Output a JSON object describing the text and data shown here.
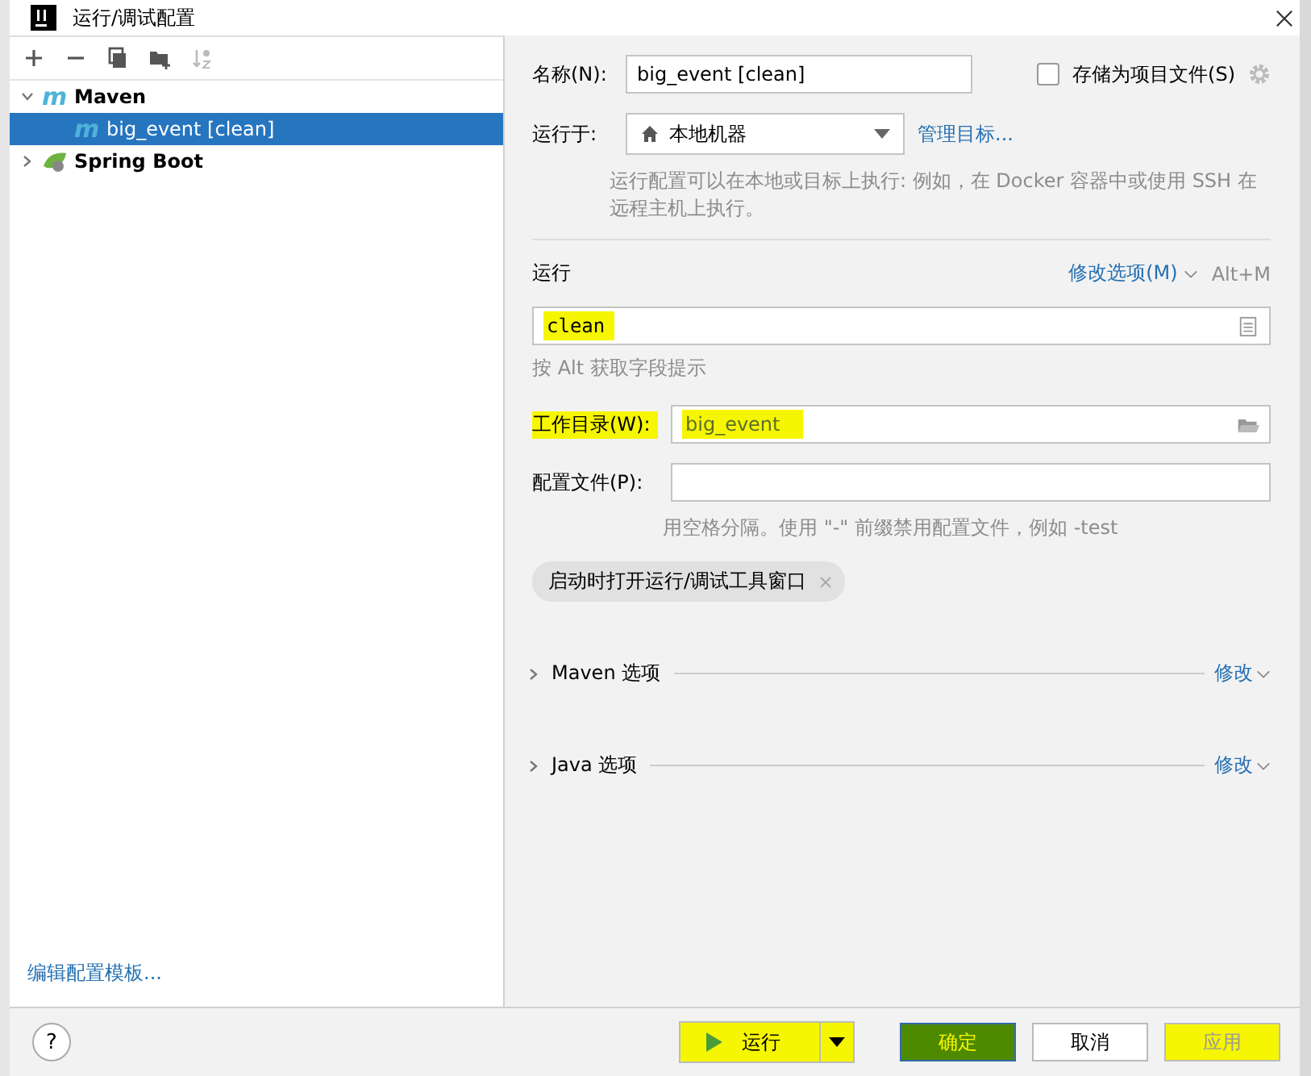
{
  "window": {
    "title": "运行/调试配置"
  },
  "tree": [
    {
      "label": "Maven",
      "kind": "maven",
      "icon": "m",
      "expanded": true,
      "selected": false,
      "children": [
        {
          "label": "big_event [clean]",
          "kind": "maven",
          "icon": "m",
          "selected": true
        }
      ]
    },
    {
      "label": "Spring Boot",
      "kind": "spring",
      "expanded": false,
      "selected": false
    }
  ],
  "edit_templates_link": "编辑配置模板...",
  "name": {
    "label": "名称(N):",
    "value": "big_event [clean]"
  },
  "store_as_file": {
    "label": "存储为项目文件(S)",
    "checked": false
  },
  "run_on": {
    "label": "运行于:",
    "value": "本地机器",
    "link": "管理目标...",
    "hint": "运行配置可以在本地或目标上执行: 例如，在 Docker 容器中或使用 SSH 在远程主机上执行。"
  },
  "run_section": {
    "title": "运行",
    "modify": "修改选项(M)",
    "shortcut": "Alt+M"
  },
  "command": {
    "value": "clean",
    "highlighted": true,
    "hint": "按 Alt 获取字段提示"
  },
  "workdir": {
    "label": "工作目录(W):",
    "value": "big_event",
    "highlighted": true
  },
  "profiles": {
    "label": "配置文件(P):",
    "hint": "用空格分隔。使用 \"-\" 前缀禁用配置文件，例如 -test"
  },
  "tag": "启动时打开运行/调试工具窗口",
  "sections": [
    {
      "label": "Maven 选项",
      "action": "修改"
    },
    {
      "label": "Java 选项",
      "action": "修改"
    }
  ],
  "help_button": "?",
  "buttons": [
    {
      "label": "运行",
      "kind": "run",
      "highlighted": true,
      "disabled": false
    },
    {
      "label": "确定",
      "kind": "primary",
      "highlighted": true,
      "disabled": false
    },
    {
      "label": "取消",
      "kind": "normal",
      "highlighted": false,
      "disabled": false
    },
    {
      "label": "应用",
      "kind": "normal",
      "highlighted": true,
      "disabled": true
    }
  ]
}
